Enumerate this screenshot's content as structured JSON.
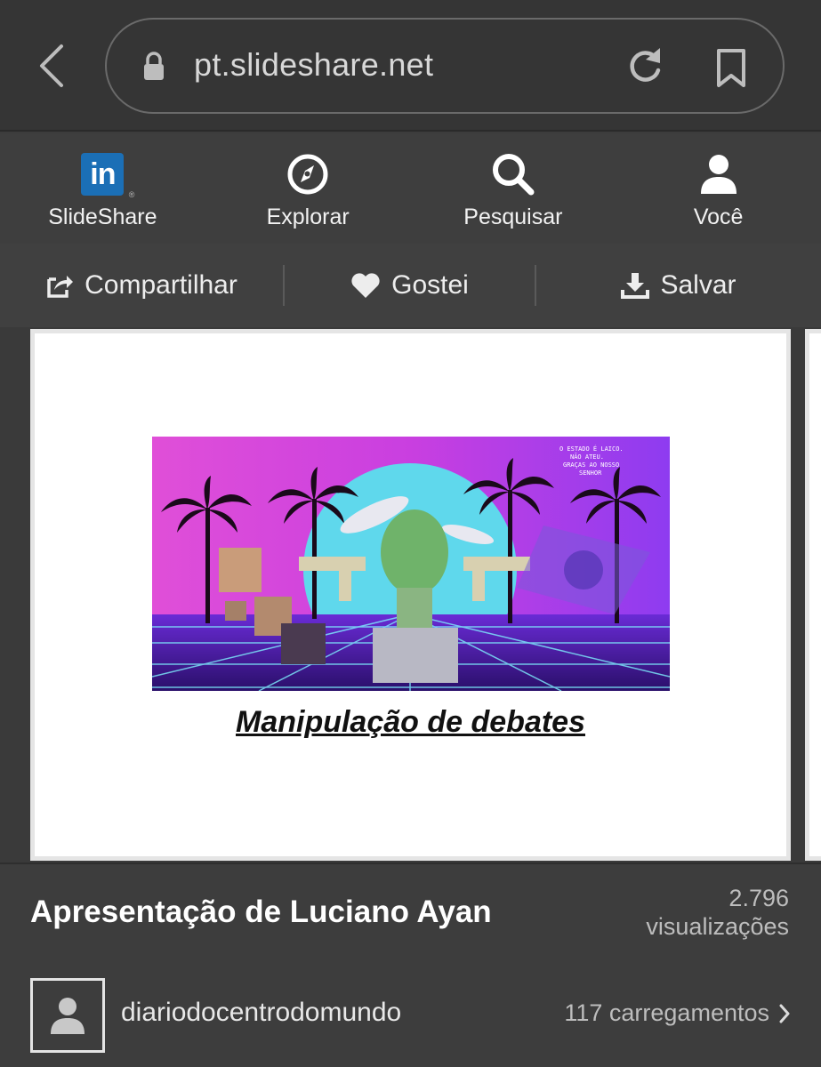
{
  "browser": {
    "url": "pt.slideshare.net"
  },
  "nav": {
    "items": [
      {
        "label": "SlideShare",
        "icon": "linkedin-logo"
      },
      {
        "label": "Explorar",
        "icon": "compass-icon"
      },
      {
        "label": "Pesquisar",
        "icon": "search-icon"
      },
      {
        "label": "Você",
        "icon": "user-icon"
      }
    ],
    "logo_text": "in"
  },
  "actions": {
    "share_label": "Compartilhar",
    "like_label": "Gostei",
    "save_label": "Salvar"
  },
  "slide": {
    "caption": "Manipulação de debates",
    "art_text": "O ESTADO É LAICO. NÃO ATEU. GRAÇAS AO NOSSO SENHOR"
  },
  "info": {
    "title": "Apresentação de Luciano Ayan",
    "views_count": "2.796",
    "views_label": "visualizações",
    "author": "diariodocentrodomundo",
    "uploads": "117 carregamentos"
  },
  "colors": {
    "linkedin_blue": "#1b6fb6",
    "background": "#3c3c3c"
  }
}
